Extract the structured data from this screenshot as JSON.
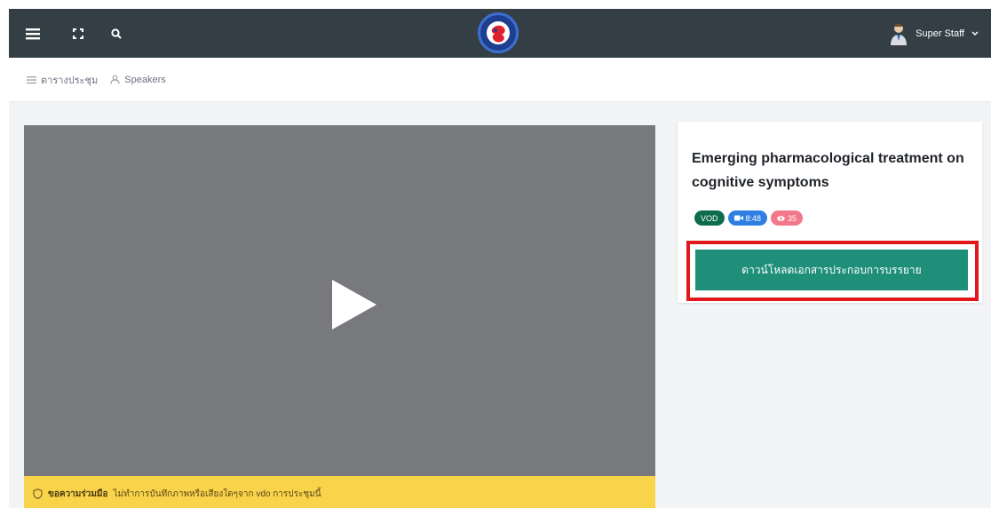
{
  "topbar": {
    "icons": [
      "menu-icon",
      "fullscreen-icon",
      "search-icon"
    ],
    "logo": "conference-logo",
    "user_name": "Super Staff"
  },
  "subnav": {
    "items": [
      {
        "label": "ตารางประชุม",
        "icon": "list-icon"
      },
      {
        "label": "Speakers",
        "icon": "user-icon"
      }
    ]
  },
  "video": {
    "play_icon": "play-icon"
  },
  "notice": {
    "icon": "shield-icon",
    "bold_text": "ขอความร่วมมือ",
    "text": "ไม่ทำการบันทึกภาพหรือเสียงใดๆจาก vdo การประชุมนี้"
  },
  "session": {
    "title": "Emerging pharmacological treatment on cognitive symptoms",
    "badges": {
      "type": "VOD",
      "duration": "8:48",
      "views": "35"
    },
    "download_label": "ดาวน์โหลดเอกสารประกอบการบรรยาย"
  },
  "colors": {
    "topbar": "#343f45",
    "download_button": "#1f8f7a",
    "highlight": "#e0171b",
    "notice": "#f9d34a"
  }
}
